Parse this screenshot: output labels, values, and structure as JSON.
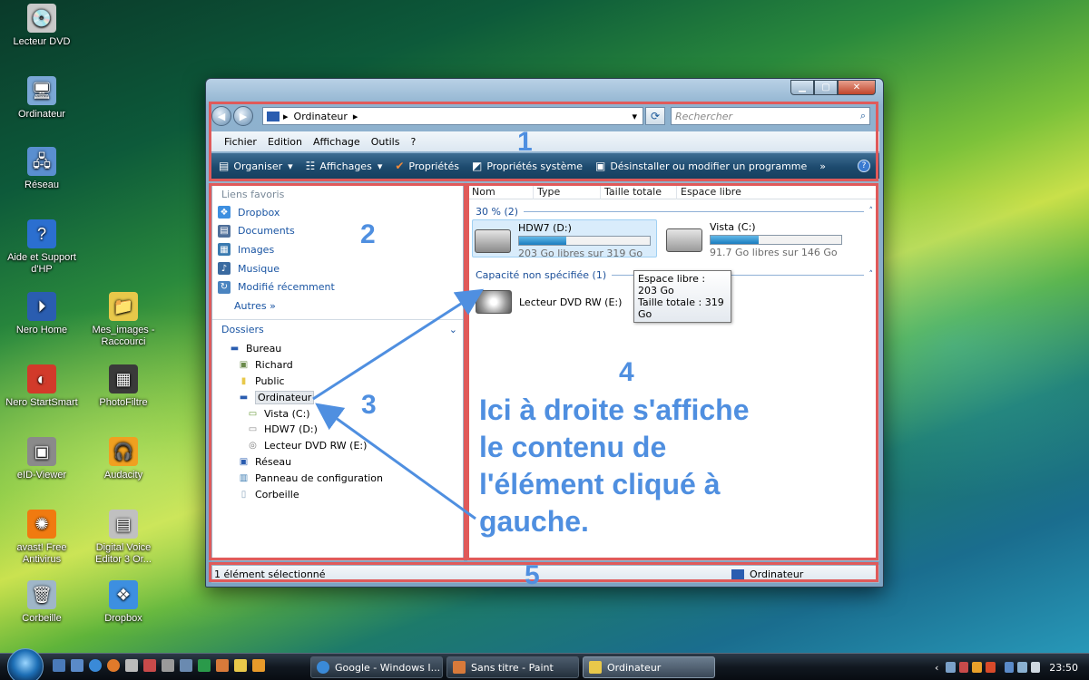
{
  "desktop": {
    "icons": [
      {
        "label": "Lecteur DVD",
        "symbol": "💿",
        "bg": "#c9c9c9"
      },
      {
        "label": "Ordinateur",
        "symbol": "🖥",
        "bg": "#7aa7d6"
      },
      {
        "label": "Réseau",
        "symbol": "🖧",
        "bg": "#5a8fd0"
      },
      {
        "label": "Aide et Support d'HP",
        "symbol": "?",
        "bg": "#2b6fd0"
      },
      {
        "label": "Nero Home",
        "symbol": "⏵",
        "bg": "#2a5db0"
      },
      {
        "label": "Mes_images - Raccourci",
        "symbol": "📁",
        "bg": "#e8c84a"
      },
      {
        "label": "Nero StartSmart",
        "symbol": "◐",
        "bg": "#d23a2a"
      },
      {
        "label": "PhotoFiltre",
        "symbol": "▦",
        "bg": "#3a3a3a"
      },
      {
        "label": "eID-Viewer",
        "symbol": "▣",
        "bg": "#8a8a8a"
      },
      {
        "label": "Audacity",
        "symbol": "🎧",
        "bg": "#f0a020"
      },
      {
        "label": "avast! Free Antivirus",
        "symbol": "✺",
        "bg": "#f07a10"
      },
      {
        "label": "Digital Voice Editor 3 Or...",
        "symbol": "▤",
        "bg": "#c0c0c0"
      },
      {
        "label": "Corbeille",
        "symbol": "🗑",
        "bg": "#9fb6c8"
      },
      {
        "label": "Dropbox",
        "symbol": "❖",
        "bg": "#3d8fe0"
      }
    ]
  },
  "window": {
    "controls": {
      "minimize": "▁",
      "maximize": "▢",
      "close": "✕"
    },
    "address": {
      "arrow1": "▸",
      "location": "Ordinateur",
      "arrow2": "▸",
      "dropdown": "▾"
    },
    "search_placeholder": "Rechercher",
    "menu": [
      "Fichier",
      "Edition",
      "Affichage",
      "Outils",
      "?"
    ],
    "toolbar": [
      {
        "label": "Organiser",
        "icon": "▤",
        "dropdown": "▾"
      },
      {
        "label": "Affichages",
        "icon": "☷",
        "dropdown": "▾"
      },
      {
        "label": "Propriétés",
        "icon": "✔",
        "dropdown": ""
      },
      {
        "label": "Propriétés système",
        "icon": "◩",
        "dropdown": ""
      },
      {
        "label": "Désinstaller ou modifier un programme",
        "icon": "▣",
        "dropdown": ""
      },
      {
        "label": "»",
        "icon": "",
        "dropdown": ""
      }
    ],
    "help_icon": "?",
    "favorites": {
      "title": "Liens favoris",
      "items": [
        {
          "label": "Dropbox",
          "color": "#3d8fe0",
          "symbol": "❖"
        },
        {
          "label": "Documents",
          "color": "#4f6f9a",
          "symbol": "▤"
        },
        {
          "label": "Images",
          "color": "#3a7ab0",
          "symbol": "▦"
        },
        {
          "label": "Musique",
          "color": "#3a6aa0",
          "symbol": "♪"
        },
        {
          "label": "Modifié récemment",
          "color": "#4a84c0",
          "symbol": "↻"
        },
        {
          "label": "Autres  »",
          "color": "",
          "symbol": ""
        }
      ]
    },
    "folders": {
      "title": "Dossiers",
      "chevron": "⌄",
      "tree": [
        {
          "label": "Bureau",
          "indent": 0,
          "symbol": "▬",
          "color": "#2a5db0",
          "selected": false
        },
        {
          "label": "Richard",
          "indent": 1,
          "symbol": "▣",
          "color": "#6a8a4a",
          "selected": false
        },
        {
          "label": "Public",
          "indent": 1,
          "symbol": "▮",
          "color": "#e8c84a",
          "selected": false
        },
        {
          "label": "Ordinateur",
          "indent": 1,
          "symbol": "▬",
          "color": "#2a5db0",
          "selected": true
        },
        {
          "label": "Vista (C:)",
          "indent": 2,
          "symbol": "▭",
          "color": "#6a9a3a",
          "selected": false
        },
        {
          "label": "HDW7 (D:)",
          "indent": 2,
          "symbol": "▭",
          "color": "#8a8a8a",
          "selected": false
        },
        {
          "label": "Lecteur DVD RW (E:)",
          "indent": 2,
          "symbol": "◎",
          "color": "#7a7a7a",
          "selected": false
        },
        {
          "label": "Réseau",
          "indent": 1,
          "symbol": "▣",
          "color": "#2a5db0",
          "selected": false
        },
        {
          "label": "Panneau de configuration",
          "indent": 1,
          "symbol": "▥",
          "color": "#3a7ab0",
          "selected": false
        },
        {
          "label": "Corbeille",
          "indent": 1,
          "symbol": "▯",
          "color": "#8aa6bc",
          "selected": false
        }
      ]
    },
    "columns": [
      "Nom",
      "Type",
      "Taille totale",
      "Espace libre"
    ],
    "groups": [
      {
        "label": "30 % (2)",
        "chevron": "˄"
      },
      {
        "label": "Capacité non spécifiée (1)",
        "chevron": "˄"
      }
    ],
    "drives": [
      {
        "name": "HDW7 (D:)",
        "free": "203 Go libres sur 319 Go",
        "used_fraction": 0.36,
        "selected": true
      },
      {
        "name": "Vista (C:)",
        "free": "91.7 Go libres sur 146 Go",
        "used_fraction": 0.37,
        "selected": false
      },
      {
        "name": "Lecteur DVD RW (E:)",
        "free": "",
        "used_fraction": null,
        "selected": false
      }
    ],
    "tooltip": {
      "line1": "Espace libre : 203 Go",
      "line2": "Taille totale : 319 Go"
    },
    "status": {
      "left": "1 élément sélectionné",
      "right": "Ordinateur"
    }
  },
  "annotations": {
    "numbers": [
      "1",
      "2",
      "3",
      "4",
      "5"
    ],
    "note_lines": [
      "Ici à droite s'affiche",
      "le contenu de",
      "l'élément cliqué à",
      "gauche."
    ],
    "box_color": "#e05a5a",
    "text_color": "#4f8fe0"
  },
  "taskbar": {
    "buttons": [
      {
        "label": "Google - Windows I...",
        "color": "#3a8ad8",
        "active": false
      },
      {
        "label": "Sans titre - Paint",
        "color": "#d87a3a",
        "active": false
      },
      {
        "label": "Ordinateur",
        "color": "#e8c84a",
        "active": true
      }
    ],
    "tray": {
      "chevron": "‹",
      "clock": "23:50"
    }
  }
}
